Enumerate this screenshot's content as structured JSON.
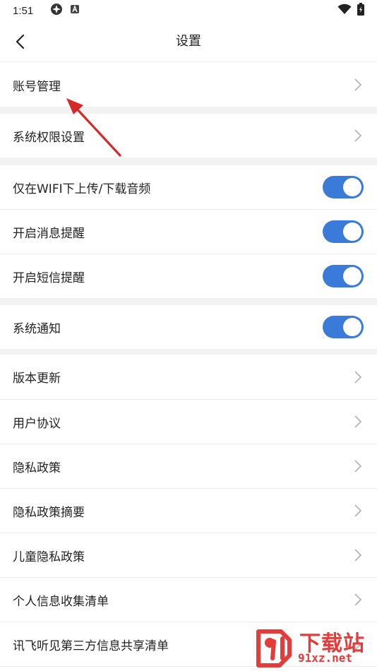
{
  "status_bar": {
    "time": "1:51",
    "left_icons": [
      "vpn-icon",
      "app-notification-icon"
    ],
    "right_icons": [
      "wifi-icon",
      "battery-icon"
    ]
  },
  "nav": {
    "back_icon": "chevron-left-icon",
    "title": "设置"
  },
  "sections": [
    {
      "items": [
        {
          "label": "账号管理",
          "type": "link"
        }
      ]
    },
    {
      "items": [
        {
          "label": "系统权限设置",
          "type": "link"
        }
      ]
    },
    {
      "items": [
        {
          "label": "仅在WIFI下上传/下载音频",
          "type": "toggle",
          "on": true
        },
        {
          "label": "开启消息提醒",
          "type": "toggle",
          "on": true
        },
        {
          "label": "开启短信提醒",
          "type": "toggle",
          "on": true
        }
      ]
    },
    {
      "items": [
        {
          "label": "系统通知",
          "type": "toggle",
          "on": true
        }
      ]
    },
    {
      "items": [
        {
          "label": "版本更新",
          "type": "link"
        },
        {
          "label": "用户协议",
          "type": "link"
        },
        {
          "label": "隐私政策",
          "type": "link"
        },
        {
          "label": "隐私政策摘要",
          "type": "link"
        },
        {
          "label": "儿童隐私政策",
          "type": "link"
        },
        {
          "label": "个人信息收集清单",
          "type": "link"
        },
        {
          "label": "讯飞听见第三方信息共享清单",
          "type": "link"
        }
      ]
    }
  ],
  "colors": {
    "toggle_on": "#3a7bd9",
    "section_gap": "#f2f2f2",
    "divider": "#ececec",
    "annotation_arrow": "#d62a2a",
    "watermark": "#e43b3b"
  },
  "watermark": {
    "logo_icon": "91-logo-icon",
    "text_cn": "下载站",
    "text_en": "91xz.net"
  }
}
